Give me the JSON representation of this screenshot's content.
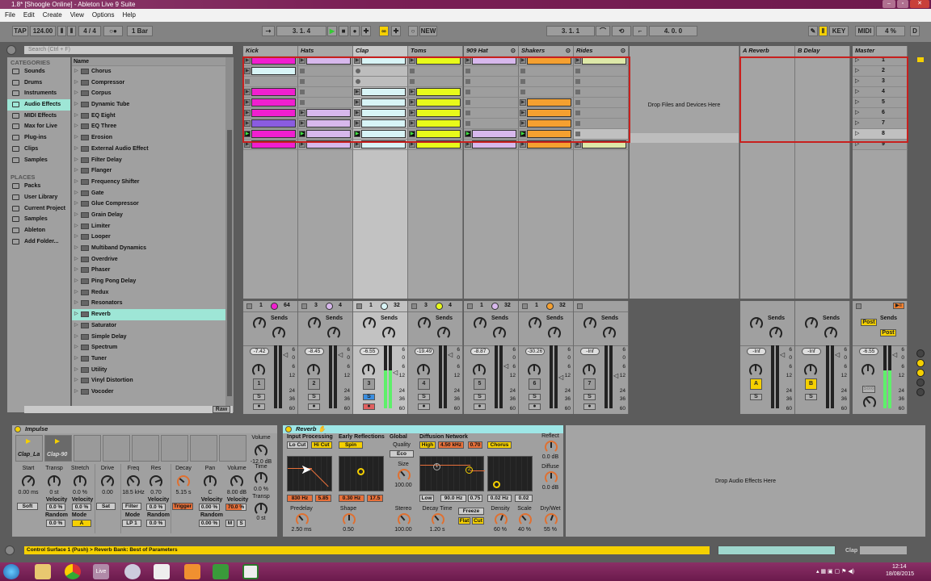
{
  "window": {
    "title": "1.8* [Shoogle Online] - Ableton Live 9 Suite"
  },
  "menu": [
    "File",
    "Edit",
    "Create",
    "View",
    "Options",
    "Help"
  ],
  "control_bar": {
    "tap": "TAP",
    "tempo": "124.00",
    "signature": "4 / 4",
    "quantization": "1 Bar",
    "position": "3. 1. 4",
    "new": "NEW",
    "loop_start": "3. 1. 1",
    "loop_length": "4. 0. 0",
    "key": "KEY",
    "midi": "MIDI",
    "cpu": "4 %",
    "disk": "D"
  },
  "browser": {
    "search_placeholder": "Search (Ctrl + F)",
    "categories_title": "CATEGORIES",
    "categories": [
      "Sounds",
      "Drums",
      "Instruments",
      "Audio Effects",
      "MIDI Effects",
      "Max for Live",
      "Plug-ins",
      "Clips",
      "Samples"
    ],
    "selected_category": "Audio Effects",
    "places_title": "PLACES",
    "places": [
      "Packs",
      "User Library",
      "Current Project",
      "Samples",
      "Ableton",
      "Add Folder..."
    ],
    "name_header": "Name",
    "items": [
      "Chorus",
      "Compressor",
      "Corpus",
      "Dynamic Tube",
      "EQ Eight",
      "EQ Three",
      "Erosion",
      "External Audio Effect",
      "Filter Delay",
      "Flanger",
      "Frequency Shifter",
      "Gate",
      "Glue Compressor",
      "Grain Delay",
      "Limiter",
      "Looper",
      "Multiband Dynamics",
      "Overdrive",
      "Phaser",
      "Ping Pong Delay",
      "Redux",
      "Resonators",
      "Reverb",
      "Saturator",
      "Simple Delay",
      "Spectrum",
      "Tuner",
      "Utility",
      "Vinyl Distortion",
      "Vocoder"
    ],
    "selected_item": "Reverb",
    "raw": "Raw"
  },
  "session": {
    "playing_scene": 8,
    "tracks": [
      {
        "name": "Kick",
        "clips": [
          "#f01fcf",
          "#d8f4f6",
          "stop",
          "#f01fcf",
          "#f01fcf",
          "#f01fcf",
          "#8a5ce0",
          "#f01fcf",
          "#f01fcf"
        ],
        "io": [
          "1",
          "64"
        ],
        "color": "#f01fcf",
        "volume": "-7.42",
        "number": "1",
        "level": 0
      },
      {
        "name": "Hats",
        "clips": [
          "#d7b8ec",
          "stop",
          "stop",
          "stop",
          "stop",
          "#d7b8ec",
          "#d7b8ec",
          "#d7b8ec",
          "#d7b8ec"
        ],
        "io": [
          "3",
          "4"
        ],
        "color": "#d7b8ec",
        "volume": "-8.45",
        "number": "2",
        "level": 0
      },
      {
        "name": "Clap",
        "clips": [
          "#d8f4f6",
          "rec",
          "rec",
          "#d8f4f6",
          "#d8f4f6",
          "#d8f4f6",
          "#d8f4f6",
          "#d8f4f6",
          "#d8f4f6"
        ],
        "io": [
          "1",
          "32"
        ],
        "color": "#d8f4f6",
        "volume": "-6.55",
        "number": "3",
        "level": 0.6,
        "selected": true
      },
      {
        "name": "Toms",
        "clips": [
          "#e8fa1a",
          "stop",
          "stop",
          "#e8fa1a",
          "#e8fa1a",
          "#e8fa1a",
          "#e8fa1a",
          "#e8fa1a",
          "#e8fa1a"
        ],
        "io": [
          "3",
          "4"
        ],
        "color": "#e8fa1a",
        "volume": "-19.49",
        "number": "4",
        "level": 0
      },
      {
        "name": "909 Hat",
        "clips": [
          "#d7b8ec",
          "stop",
          "stop",
          "stop",
          "stop",
          "stop",
          "stop",
          "#d7b8ec",
          "#d7b8ec"
        ],
        "io": [
          "1",
          "32"
        ],
        "color": "#d7b8ec",
        "volume": "-8.87",
        "number": "5",
        "level": 0
      },
      {
        "name": "Shakers",
        "clips": [
          "#f5a030",
          "stop",
          "stop",
          "stop",
          "#f5a030",
          "#f5a030",
          "#f5a030",
          "#f5a030",
          "#f5a030"
        ],
        "io": [
          "1",
          "32"
        ],
        "color": "#f5a030",
        "volume": "-30.26",
        "number": "6",
        "level": 0
      },
      {
        "name": "Rides",
        "clips": [
          "#dde8a8",
          "stop",
          "stop",
          "stop",
          "stop",
          "stop",
          "stop",
          "stop",
          "#dde8a8"
        ],
        "io": [
          "",
          ""
        ],
        "color": "",
        "volume": "-Inf",
        "number": "7",
        "level": 0
      }
    ],
    "drop_text": "Drop Files and Devices Here",
    "returns": [
      {
        "name": "A Reverb",
        "volume": "-Inf",
        "letter": "A"
      },
      {
        "name": "B Delay",
        "volume": "-Inf",
        "letter": "B"
      }
    ],
    "master": {
      "name": "Master",
      "volume": "-6.55",
      "scenes": [
        "1",
        "2",
        "3",
        "4",
        "5",
        "6",
        "7",
        "8",
        "9"
      ],
      "post": "Post",
      "solo": "Solo",
      "level": 0.6
    },
    "sends_label": "Sends",
    "send_a": "A",
    "send_b": "B",
    "solo_label": "S",
    "meter_scale": [
      "6",
      "0",
      "6",
      "12",
      "24",
      "36",
      "60"
    ]
  },
  "impulse": {
    "title": "Impulse",
    "pads": [
      "Clap_La",
      "Clap-90",
      "",
      "",
      "",
      "",
      "",
      ""
    ],
    "volume": {
      "label": "Volume",
      "value": "-12.0 dB"
    },
    "time": {
      "label": "Time",
      "value": "0.0 %"
    },
    "transp2": {
      "label": "Transp",
      "value": "0 st"
    },
    "start": {
      "label": "Start",
      "value": "0.00 ms",
      "button": "Soft"
    },
    "transp": {
      "label": "Transp",
      "value": "0 st",
      "velocity": "0.0 %",
      "random": "0.0 %"
    },
    "stretch": {
      "label": "Stretch",
      "value": "0.0 %",
      "velocity": "0.0 %",
      "mode": "A"
    },
    "drive": {
      "label": "Drive",
      "value": "0.00",
      "button": "Sat"
    },
    "freq": {
      "label": "Freq",
      "value": "18.5 kHz",
      "button": "Filter",
      "mode": "LP 1"
    },
    "res": {
      "label": "Res",
      "value": "0.70",
      "velocity": "0.0 %",
      "random": "0.0 %"
    },
    "decay": {
      "label": "Decay",
      "value": "5.15 s",
      "button": "Trigger"
    },
    "pan": {
      "label": "Pan",
      "value": "C",
      "velocity": "0.00 %",
      "random": "0.00 %"
    },
    "vol": {
      "label": "Volume",
      "value": "8.00 dB",
      "velocity": "70.0 %",
      "m": "M",
      "s": "S"
    },
    "velocity_label": "Velocity",
    "random_label": "Random",
    "mode_label": "Mode"
  },
  "reverb": {
    "title": "Reverb",
    "input_processing": "Input Processing",
    "lo_cut": "Lo Cut",
    "hi_cut": "Hi Cut",
    "in_freq": "830 Hz",
    "in_width": "5.85",
    "early_reflections": "Early Reflections",
    "spin": "Spin",
    "er_freq": "0.30 Hz",
    "er_amount": "17.5",
    "global": "Global",
    "quality_label": "Quality",
    "quality": "Eco",
    "size_label": "Size",
    "size": "100.00",
    "diffusion": "Diffusion Network",
    "high": "High",
    "high_freq": "4.50 kHz",
    "high_val": "0.70",
    "chorus": "Chorus",
    "low": "Low",
    "low_freq": "90.0 Hz",
    "low_val": "0.75",
    "chorus_rate": "0.02 Hz",
    "chorus_amt": "0.02",
    "reflect_label": "Reflect",
    "reflect": "0.0 dB",
    "diffuse_label": "Diffuse",
    "diffuse": "0.0 dB",
    "predelay_label": "Predelay",
    "predelay": "2.50 ms",
    "shape_label": "Shape",
    "shape": "0.50",
    "stereo_label": "Stereo",
    "stereo": "100.00",
    "decay_label": "Decay Time",
    "decay": "1.20 s",
    "freeze": "Freeze",
    "flat": "Flat",
    "cut": "Cut",
    "density_label": "Density",
    "density": "60 %",
    "scale_label": "Scale",
    "scale": "40 %",
    "drywet_label": "Dry/Wet",
    "drywet": "55 %",
    "node1": "1",
    "node2": "2"
  },
  "drop_effects": "Drop Audio Effects Here",
  "status": {
    "message": "Control Surface 1 (Push) > Reverb Bank: Best of Parameters",
    "track": "Clap"
  },
  "taskbar": {
    "time": "12:14",
    "date": "18/08/2015",
    "live": "Live"
  }
}
